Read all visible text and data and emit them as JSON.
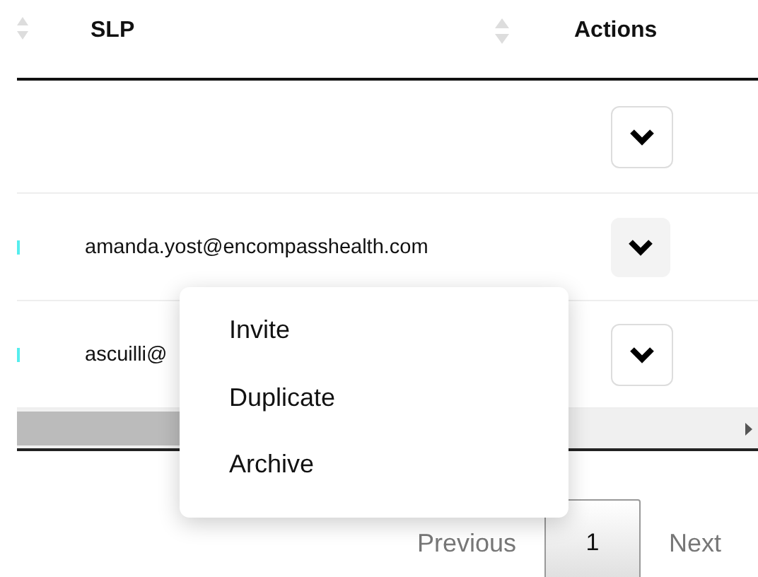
{
  "table": {
    "columns": [
      {
        "label": "SLP",
        "sortable": true
      },
      {
        "label": "Actions",
        "sortable": false
      }
    ],
    "rows": [
      {
        "slp": "",
        "marker": false,
        "action_highlighted": false
      },
      {
        "slp": "amanda.yost@encompasshealth.com",
        "marker": true,
        "action_highlighted": true
      },
      {
        "slp": "ascuilli@",
        "marker": true,
        "action_highlighted": false
      }
    ]
  },
  "dropdown_menu": {
    "items": [
      "Invite",
      "Duplicate",
      "Archive"
    ]
  },
  "pagination": {
    "previous": {
      "label": "Previous",
      "disabled": true
    },
    "pages": [
      {
        "label": "1",
        "selected": true
      }
    ],
    "next": {
      "label": "Next",
      "disabled": true
    }
  }
}
